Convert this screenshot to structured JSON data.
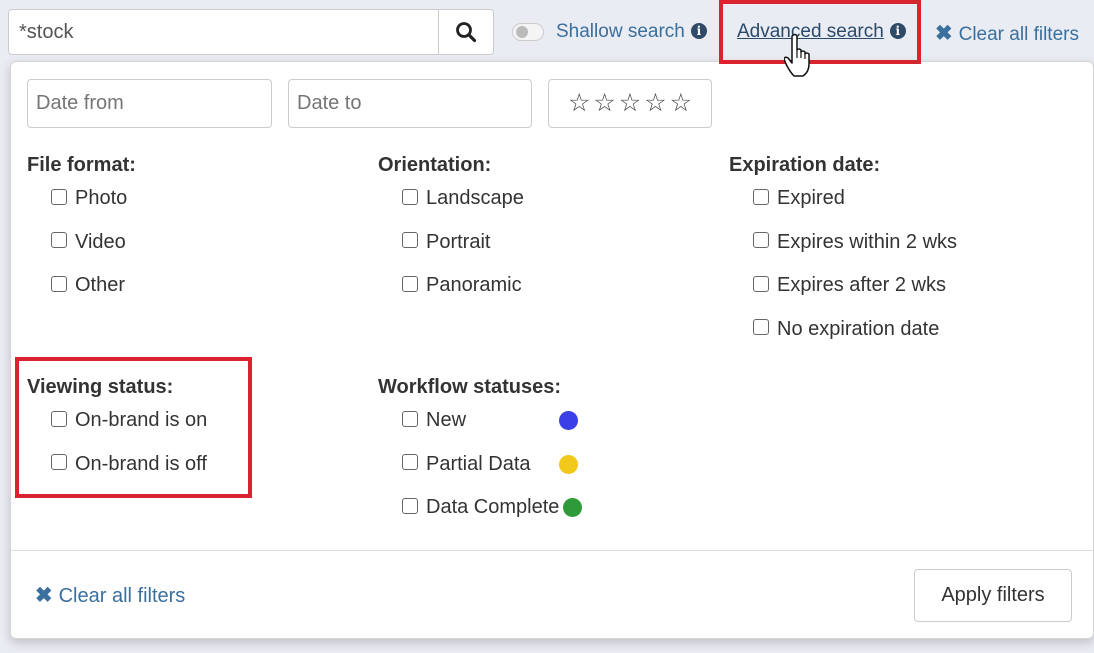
{
  "search": {
    "value": "*stock",
    "search_icon": "search-icon"
  },
  "toolbar": {
    "shallow_search_label": "Shallow search",
    "shallow_search_enabled": false,
    "advanced_search_label": "Advanced search",
    "clear_all_label": "Clear all filters",
    "info_glyph": "i",
    "clear_glyph": "✖"
  },
  "filters": {
    "date_from_placeholder": "Date from",
    "date_to_placeholder": "Date to",
    "rating": {
      "max": 5,
      "value": 0,
      "glyph": "☆"
    },
    "file_format": {
      "title": "File format:",
      "options": [
        "Photo",
        "Video",
        "Other"
      ]
    },
    "orientation": {
      "title": "Orientation:",
      "options": [
        "Landscape",
        "Portrait",
        "Panoramic"
      ]
    },
    "expiration": {
      "title": "Expiration date:",
      "options": [
        "Expired",
        "Expires within 2 wks",
        "Expires after 2 wks",
        "No expiration date"
      ]
    },
    "viewing_status": {
      "title": "Viewing status:",
      "options": [
        "On-brand is on",
        "On-brand is off"
      ]
    },
    "workflow": {
      "title": "Workflow statuses:",
      "options": [
        {
          "label": "New",
          "color": "#3b3fe8"
        },
        {
          "label": "Partial Data",
          "color": "#f2c81a"
        },
        {
          "label": "Data Complete",
          "color": "#2e9a3a"
        }
      ]
    }
  },
  "footer": {
    "clear_all_label": "Clear all filters",
    "apply_label": "Apply filters"
  }
}
